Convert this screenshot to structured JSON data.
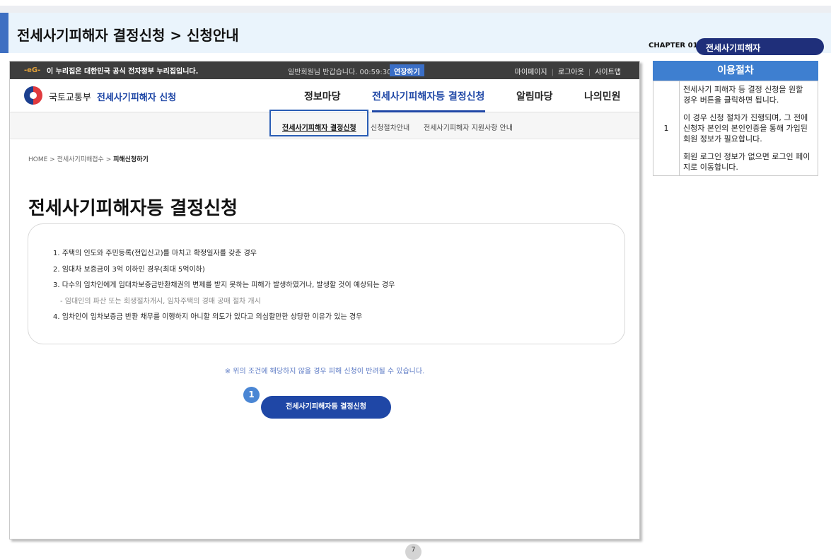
{
  "doc": {
    "title": "전세사기피해자 결정신청 > 신청안내",
    "chapter": "CHAPTER 01",
    "chapter_tag": "전세사기피해자",
    "page_number": "7"
  },
  "gov_bar": {
    "logo": "-eG-",
    "notice": "이 누리집은 대한민국 공식 전자정부 누리집입니다.",
    "greeting": "일반회원님 반갑습니다. 00:59:30",
    "extend_label": "연장하기",
    "links": [
      "마이페이지",
      "로그아웃",
      "사이트맵"
    ]
  },
  "nav": {
    "ministry": "국토교통부",
    "service": "전세사기피해자 신청",
    "menu": [
      "정보마당",
      "전세사기피해자등 결정신청",
      "알림마당",
      "나의민원"
    ]
  },
  "subnav": [
    "전세사기피해자 결정신청",
    "신청절차안내",
    "전세사기피해자 지원사항 안내"
  ],
  "breadcrumb": {
    "home": "HOME",
    "section": "전세사기피해접수",
    "current": "피해신청하기"
  },
  "main": {
    "page_title": "전세사기피해자등 결정신청",
    "conditions": [
      "1. 주택의 인도와 주민등록(전입신고)를 마치고 확정일자를 갖춘 경우",
      "2. 임대차 보증금이 3억 이하인 경우(최대 5억이하)",
      "3. 다수의 임차인에게 임대차보증금반환채권의 변제를 받지 못하는 피해가 발생하였거나, 발생할 것이 예상되는 경우",
      "- 임대인의 파산 또는 회생절차개시, 임차주택의 경매 공매 절차 개시",
      "4. 임차인이 임차보증금 반환 채무를 이행하지 아니할 의도가 있다고 의심할만한 상당한 이유가 있는 경우"
    ],
    "warning": "※ 위의 조건에 해당하지 않을 경우 피해 신청이 반려될 수 있습니다.",
    "step_badge": "1",
    "apply_button": "전세사기피해자등 결정신청"
  },
  "side_panel": {
    "heading": "이용절차",
    "row_num": "1",
    "desc1": "전세사기 피해자 등 결정 신청을 원할 경우 버튼을 클릭하면 됩니다.",
    "desc2": "이 경우 신청 절차가 진행되며, 그 전에 신청자 본인의 본인인증을 통해 가입된 회원 정보가 필요합니다.",
    "desc3": "회원 로그인 정보가 없으면 로그인 페이지로 이동합니다."
  },
  "colors": {
    "accent": "#1f47a6",
    "header_bg": "#eaf4fc",
    "side_head": "#3e7fd0"
  }
}
